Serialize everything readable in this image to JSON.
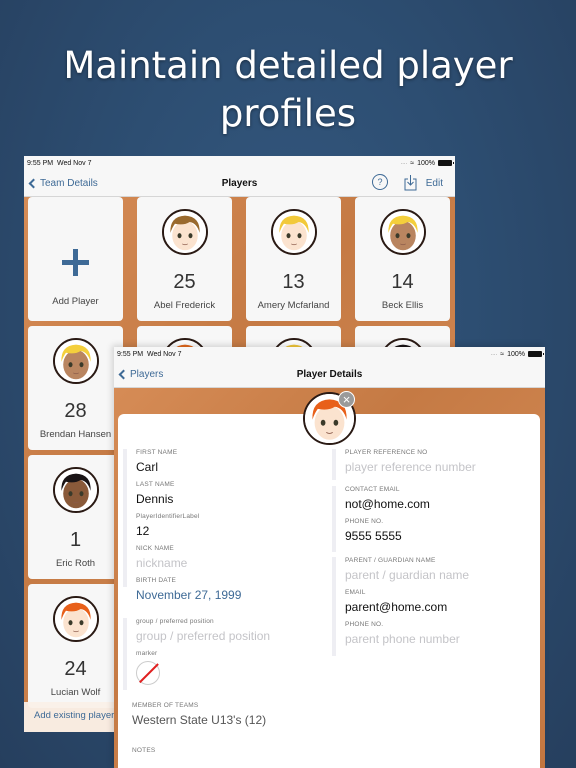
{
  "headline": "Maintain detailed player profiles",
  "players_screen": {
    "status": {
      "time": "9:55 PM",
      "date": "Wed Nov 7",
      "signal": "....",
      "battery": "100%"
    },
    "nav": {
      "back_label": "Team Details",
      "title": "Players",
      "help_label": "?",
      "edit_label": "Edit"
    },
    "add_card": {
      "label": "Add Player"
    },
    "players": [
      {
        "number": "25",
        "name": "Abel Frederick",
        "hair": "#9a6a2e",
        "skin": "#fbe3cf"
      },
      {
        "number": "13",
        "name": "Amery Mcfarland",
        "hair": "#f2c93a",
        "skin": "#fbe3cf"
      },
      {
        "number": "14",
        "name": "Beck Ellis",
        "hair": "#f4cf3c",
        "skin": "#b98560"
      },
      {
        "number": "28",
        "name": "Brendan Hansen",
        "hair": "#f4cf3c",
        "skin": "#b98560"
      },
      {
        "number": "",
        "name": "",
        "hair": "#e46a1e",
        "skin": "#fbe3cf"
      },
      {
        "number": "",
        "name": "",
        "hair": "#f2c93a",
        "skin": "#fbe3cf"
      },
      {
        "number": "",
        "name": "",
        "hair": "#1a1416",
        "skin": "#8a5a3a"
      },
      {
        "number": "1",
        "name": "Eric Roth",
        "hair": "#1a1416",
        "skin": "#8a5a3a"
      },
      {
        "number": "24",
        "name": "Lucian Wolf",
        "hair": "#e8601a",
        "skin": "#fbe3cf"
      }
    ],
    "bottom_action": "Add existing player"
  },
  "details_screen": {
    "status": {
      "time": "9:55 PM",
      "date": "Wed Nov 7",
      "signal": "....",
      "battery": "100%"
    },
    "nav": {
      "back_label": "Players",
      "title": "Player Details"
    },
    "avatar": {
      "hair": "#e8601a",
      "skin": "#fbe3cf",
      "remove_label": "×"
    },
    "left": {
      "first_name_label": "FIRST NAME",
      "first_name": "Carl",
      "last_name_label": "LAST NAME",
      "last_name": "Dennis",
      "identifier_label": "PlayerIdentifierLabel",
      "identifier": "12",
      "nick_name_label": "NICK NAME",
      "nick_name_placeholder": "nickname",
      "birth_date_label": "BIRTH DATE",
      "birth_date": "November 27, 1999",
      "group_label": "group / preferred position",
      "group_placeholder": "group / preferred position",
      "marker_label": "marker",
      "teams_label": "MEMBER OF TEAMS",
      "teams": "Western State U13's (12)",
      "notes_label": "NOTES"
    },
    "right": {
      "ref_label": "PLAYER REFERENCE NO",
      "ref_placeholder": "player reference number",
      "contact_email_label": "CONTACT EMAIL",
      "contact_email": "not@home.com",
      "phone_label": "PHONE NO.",
      "phone": "9555 5555",
      "parent_name_label": "PARENT / GUARDIAN NAME",
      "parent_name_placeholder": "parent / guardian name",
      "parent_email_label": "EMAIL",
      "parent_email": "parent@home.com",
      "parent_phone_label": "PHONE NO.",
      "parent_phone_placeholder": "parent phone number"
    }
  }
}
